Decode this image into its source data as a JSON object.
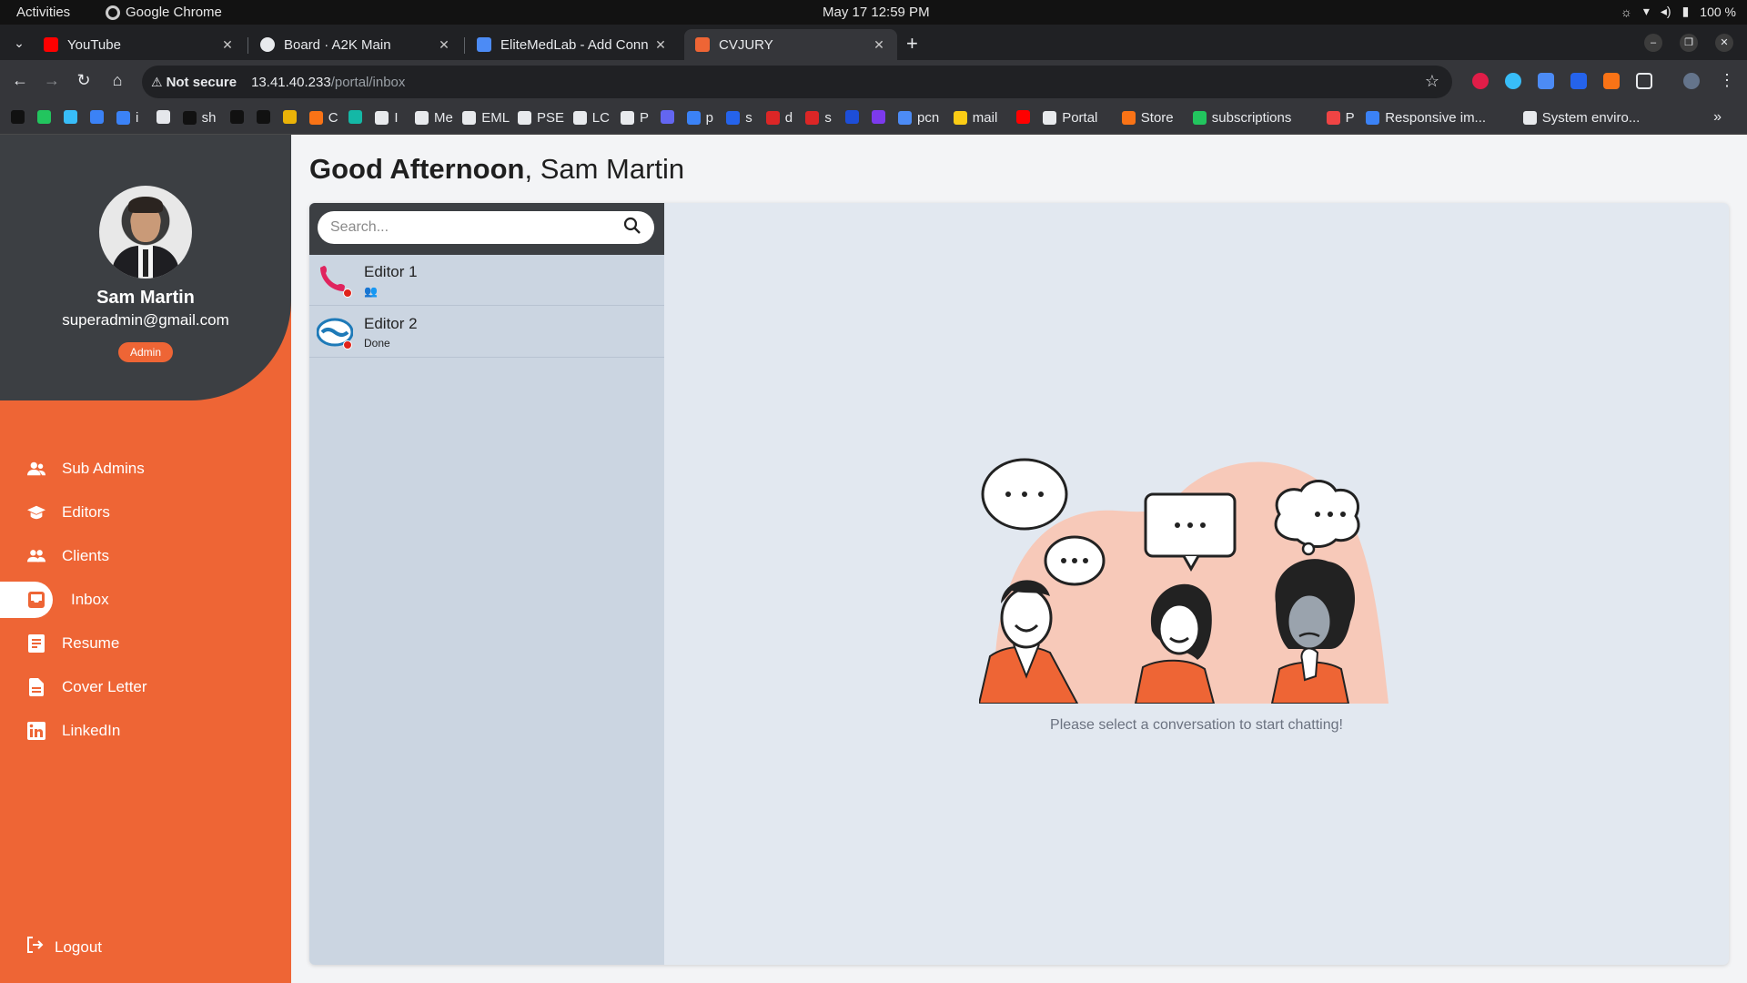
{
  "os_bar": {
    "activities": "Activities",
    "app_name": "Google Chrome",
    "clock": "May 17  12:59 PM",
    "battery": "100 %"
  },
  "tabs": [
    {
      "title": "YouTube",
      "color": "#ff0000"
    },
    {
      "title": "Board · A2K Main",
      "color": "#e8eaed"
    },
    {
      "title": "EliteMedLab - Add Conn",
      "color": "#4c8bf5"
    },
    {
      "title": "CVJURY",
      "color": "#ee6535"
    }
  ],
  "toolbar": {
    "security": "Not secure",
    "url_host": "13.41.40.233",
    "url_path": "/portal/inbox"
  },
  "bookmarks": [
    {
      "label": "",
      "color": "#111111"
    },
    {
      "label": "",
      "color": "#22c55e"
    },
    {
      "label": "",
      "color": "#38bdf8"
    },
    {
      "label": "",
      "color": "#3b82f6"
    },
    {
      "label": "i",
      "color": "#3b82f6"
    },
    {
      "label": "",
      "color": "#e5e7eb"
    },
    {
      "label": "sh",
      "color": "#111111"
    },
    {
      "label": "",
      "color": "#111111"
    },
    {
      "label": "",
      "color": "#111111"
    },
    {
      "label": "",
      "color": "#eab308"
    },
    {
      "label": "C",
      "color": "#f97316"
    },
    {
      "label": "",
      "color": "#14b8a6"
    },
    {
      "label": "I",
      "color": "#e8eaed"
    },
    {
      "label": "Me",
      "color": "#e8eaed"
    },
    {
      "label": "EML",
      "color": "#e8eaed"
    },
    {
      "label": "PSE",
      "color": "#e8eaed"
    },
    {
      "label": "LC",
      "color": "#e8eaed"
    },
    {
      "label": "P",
      "color": "#e8eaed"
    },
    {
      "label": "",
      "color": "#6366f1"
    },
    {
      "label": "p",
      "color": "#3b82f6"
    },
    {
      "label": "s",
      "color": "#2563eb"
    },
    {
      "label": "d",
      "color": "#dc2626"
    },
    {
      "label": "s",
      "color": "#dc2626"
    },
    {
      "label": "",
      "color": "#1d4ed8"
    },
    {
      "label": "",
      "color": "#7c3aed"
    },
    {
      "label": "pcn",
      "color": "#4c8bf5"
    },
    {
      "label": "mail",
      "color": "#facc15"
    },
    {
      "label": "",
      "color": "#ff0000"
    },
    {
      "label": "Portal",
      "color": "#e8eaed"
    },
    {
      "label": "Store",
      "color": "#f97316"
    },
    {
      "label": "subscriptions",
      "color": "#22c55e"
    },
    {
      "label": "P",
      "color": "#ef4444"
    },
    {
      "label": "Responsive im...",
      "color": "#3b82f6"
    },
    {
      "label": "System enviro...",
      "color": "#e8eaed"
    }
  ],
  "user": {
    "name": "Sam Martin",
    "email": "superadmin@gmail.com",
    "role": "Admin"
  },
  "nav": [
    {
      "label": "Sub Admins",
      "icon": "users-icon"
    },
    {
      "label": "Editors",
      "icon": "graduation-cap-icon"
    },
    {
      "label": "Clients",
      "icon": "group-icon"
    },
    {
      "label": "Inbox",
      "icon": "inbox-icon",
      "active": true
    },
    {
      "label": "Resume",
      "icon": "document-icon"
    },
    {
      "label": "Cover Letter",
      "icon": "file-icon"
    },
    {
      "label": "LinkedIn",
      "icon": "linkedin-icon"
    }
  ],
  "logout_label": "Logout",
  "greeting": {
    "bold": "Good Afternoon",
    "rest": ", Sam Martin"
  },
  "search": {
    "placeholder": "Search..."
  },
  "conversations": [
    {
      "name": "Editor 1",
      "preview": "👥",
      "status": "offline"
    },
    {
      "name": "Editor 2",
      "preview": "Done",
      "status": "offline"
    }
  ],
  "empty_state": "Please select a conversation to start chatting!",
  "colors": {
    "accent": "#ee6535",
    "sidebar_dark": "#3c3f43",
    "list_bg": "#cbd5e1",
    "panel_bg": "#e2e8f0"
  }
}
